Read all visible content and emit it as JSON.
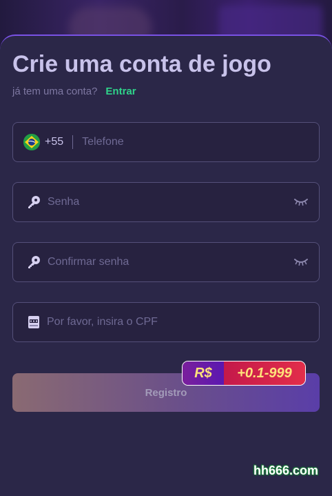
{
  "header": {
    "title": "Crie uma conta de jogo",
    "question": "já tem uma conta?",
    "login_link": "Entrar"
  },
  "form": {
    "phone": {
      "country_code": "+55",
      "placeholder": "Telefone",
      "flag_icon": "brazil-flag-icon"
    },
    "password": {
      "placeholder": "Senha",
      "icon": "key-icon",
      "toggle_icon": "eye-closed-icon"
    },
    "confirm_password": {
      "placeholder": "Confirmar senha",
      "icon": "key-icon",
      "toggle_icon": "eye-closed-icon"
    },
    "cpf": {
      "placeholder": "Por favor, insira o CPF",
      "icon": "cpf-card-icon"
    }
  },
  "register_button": {
    "label": "Registro"
  },
  "promo_badge": {
    "currency": "R$",
    "amount": "+0.1-999"
  },
  "watermark": "hh666.com",
  "colors": {
    "accent_link": "#2fd38a",
    "sheet_border": "#7a52e6",
    "promo_text": "#ffe27a"
  }
}
